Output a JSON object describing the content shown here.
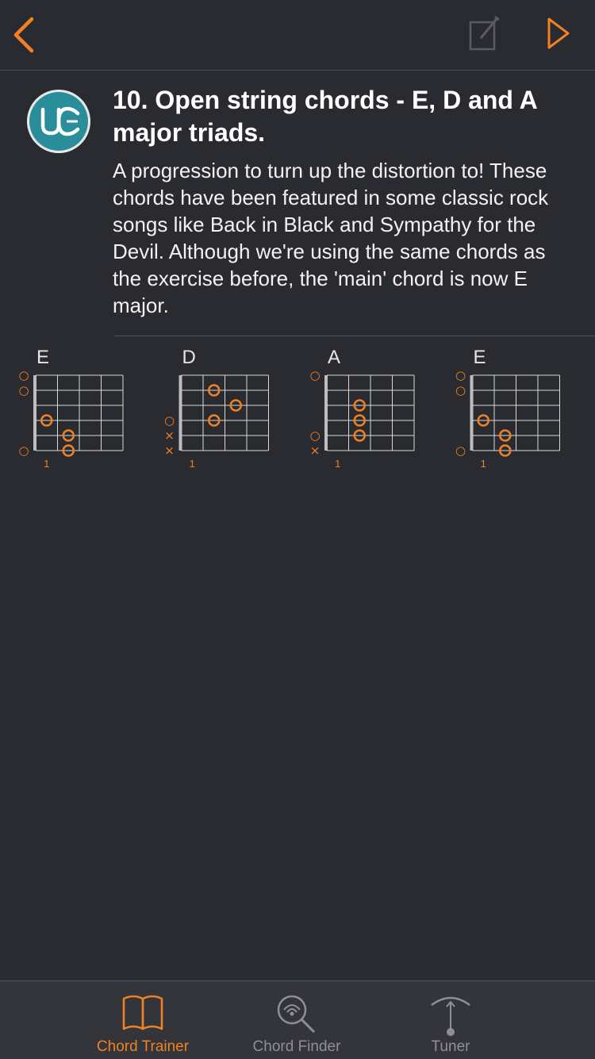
{
  "lesson": {
    "title": "10. Open string chords - E, D and A major triads.",
    "description": "A progression to turn up the distortion to! These chords have been featured in some classic rock songs like Back in Black and Sympathy for the Devil. Although we're using the same chords as the exercise before, the 'main' chord is now E major."
  },
  "logo_icon": "uc-logo",
  "colors": {
    "accent": "#f08125",
    "background": "#2a2b30",
    "logo": "#2a8e9a"
  },
  "chords": [
    {
      "name": "E",
      "fret_label": "1",
      "string_marks": [
        "○",
        "○",
        "",
        "",
        "",
        "○"
      ],
      "dots": [
        {
          "string": 3,
          "fret": 1
        },
        {
          "string": 4,
          "fret": 2
        },
        {
          "string": 5,
          "fret": 2
        }
      ]
    },
    {
      "name": "D",
      "fret_label": "1",
      "string_marks": [
        "",
        "",
        "",
        "○",
        "×",
        "×"
      ],
      "dots": [
        {
          "string": 1,
          "fret": 2
        },
        {
          "string": 2,
          "fret": 3
        },
        {
          "string": 3,
          "fret": 2
        }
      ]
    },
    {
      "name": "A",
      "fret_label": "1",
      "string_marks": [
        "○",
        "",
        "",
        "",
        "○",
        "×"
      ],
      "dots": [
        {
          "string": 2,
          "fret": 2
        },
        {
          "string": 3,
          "fret": 2
        },
        {
          "string": 4,
          "fret": 2
        }
      ]
    },
    {
      "name": "E",
      "fret_label": "1",
      "string_marks": [
        "○",
        "○",
        "",
        "",
        "",
        "○"
      ],
      "dots": [
        {
          "string": 3,
          "fret": 1
        },
        {
          "string": 4,
          "fret": 2
        },
        {
          "string": 5,
          "fret": 2
        }
      ]
    }
  ],
  "tabs": [
    {
      "label": "Chord Trainer",
      "icon": "book-icon",
      "active": true
    },
    {
      "label": "Chord Finder",
      "icon": "magnifier-signal-icon",
      "active": false
    },
    {
      "label": "Tuner",
      "icon": "tuner-icon",
      "active": false
    }
  ]
}
